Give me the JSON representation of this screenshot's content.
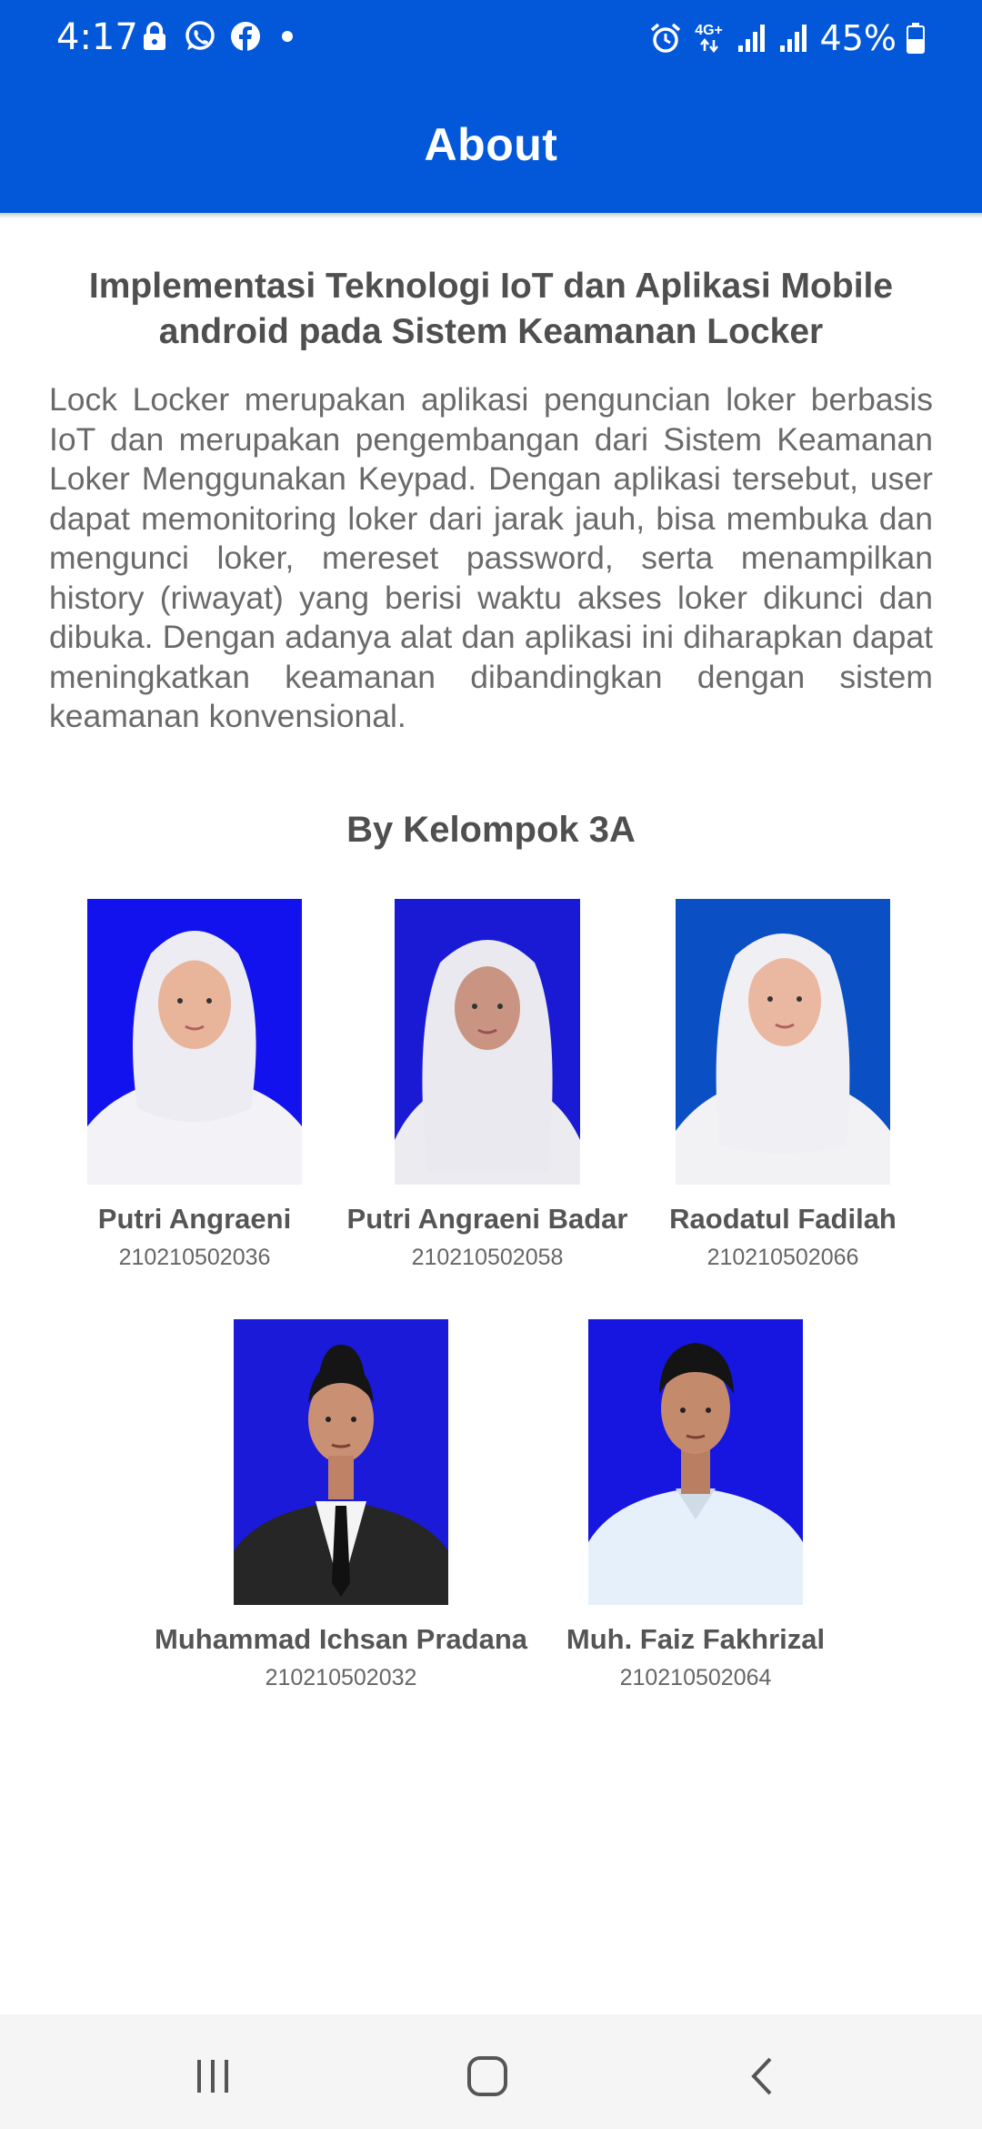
{
  "status_bar": {
    "time": "4:17",
    "network": "4G+",
    "battery": "45%",
    "icons": [
      "lock-icon",
      "whatsapp-icon",
      "facebook-icon",
      "notification-dot",
      "alarm-icon",
      "signal-icon",
      "battery-icon"
    ]
  },
  "app_bar": {
    "title": "About"
  },
  "about": {
    "heading": "Implementasi Teknologi IoT dan Aplikasi Mobile android pada Sistem Keamanan Locker",
    "description": "Lock Locker merupakan aplikasi penguncian loker berbasis IoT dan merupakan pengembangan dari Sistem Keamanan Loker Menggunakan Keypad. Dengan aplikasi tersebut, user dapat memonitoring loker dari jarak jauh, bisa membuka dan mengunci loker, mereset password, serta menampilkan history (riwayat) yang berisi waktu akses loker dikunci dan dibuka. Dengan adanya alat dan aplikasi ini diharapkan dapat meningkatkan keamanan dibandingkan dengan sistem keamanan konvensional."
  },
  "team": {
    "title": "By Kelompok 3A",
    "members": [
      {
        "name": "Putri Angraeni",
        "id": "210210502036"
      },
      {
        "name": "Putri Angraeni Badar",
        "id": "210210502058"
      },
      {
        "name": "Raodatul Fadilah",
        "id": "210210502066"
      },
      {
        "name": "Muhammad Ichsan Pradana",
        "id": "210210502032"
      },
      {
        "name": "Muh. Faiz Fakhrizal",
        "id": "210210502064"
      }
    ]
  },
  "nav_bar": {
    "buttons": [
      "recent-apps",
      "home",
      "back"
    ]
  },
  "colors": {
    "primary": "#0357d9",
    "photo_bg": "#1a1ae6",
    "text": "#555555"
  }
}
